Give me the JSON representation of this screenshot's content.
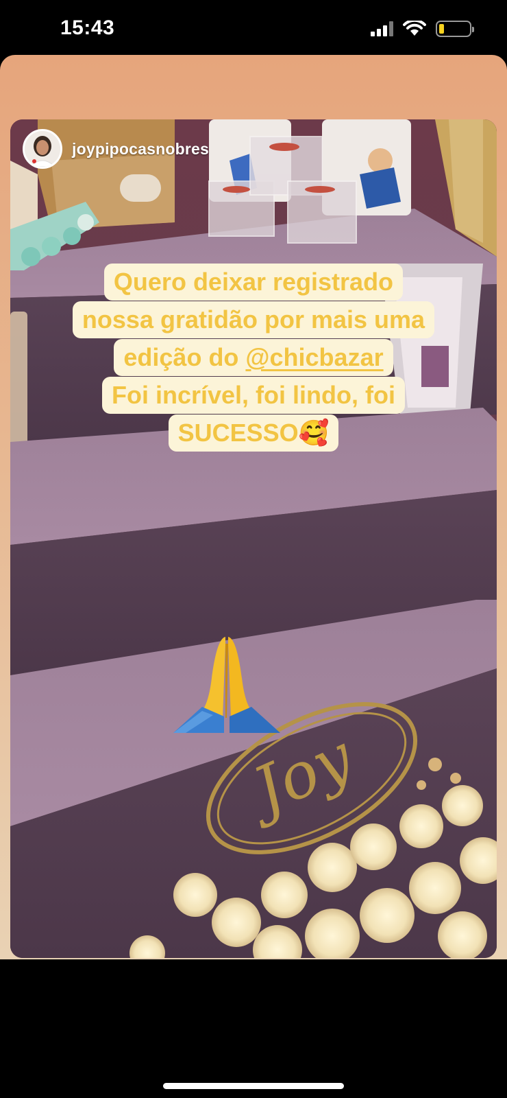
{
  "status_bar": {
    "time": "15:43",
    "icons": [
      "cellular-signal-icon",
      "wifi-icon",
      "battery-low-icon"
    ],
    "battery_color": "#f7d21e"
  },
  "story": {
    "username": "joypipocasnobres",
    "caption_lines": [
      "Quero deixar registrado",
      "nossa gratidão por mais uma",
      "edição do ",
      "Foi incrível, foi lindo, foi",
      "SUCESSO"
    ],
    "mention": "@chicbazar",
    "caption_emoji": "🥰",
    "sticker_emoji": "🙏",
    "sign_text": "Joy",
    "colors": {
      "frame_top": "#e6a57c",
      "caption_bg": "#fcf4d8",
      "caption_text": "#f2c443",
      "shelf": "#8b6f88"
    }
  }
}
